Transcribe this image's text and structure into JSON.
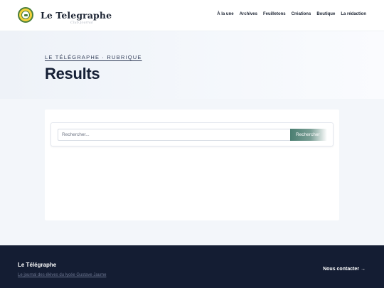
{
  "header": {
    "brand_name": "Le Telegraphe",
    "brand_tagline": "Club Journal",
    "nav": [
      "À la une",
      "Archives",
      "Feuilletons",
      "Créations",
      "Boutique",
      "La rédaction"
    ]
  },
  "hero": {
    "kicker": "LE TÉLÉGRAPHE · RUBRIQUE",
    "title": "Results"
  },
  "search": {
    "placeholder": "Rechercher...",
    "button_label": "Rechercher"
  },
  "footer": {
    "title": "Le Télégraphe",
    "subtitle": "Le journal des élèves du lycée Gustave Jaume",
    "contact_label": "Nous contacter →"
  },
  "colors": {
    "accent": "#4a7e71",
    "footer_bg": "#141d33",
    "logo_yellow": "#f4d23c",
    "logo_green": "#4b7f3a"
  }
}
